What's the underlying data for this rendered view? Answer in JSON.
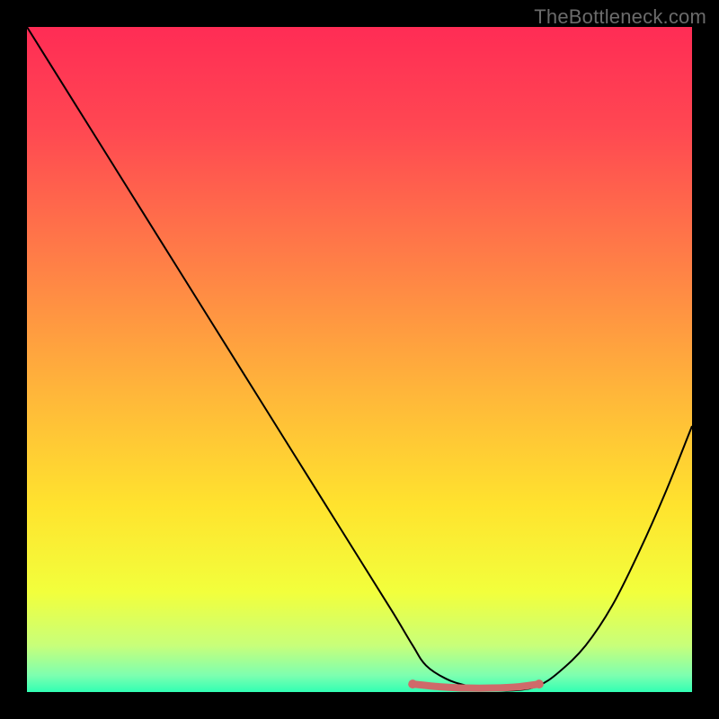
{
  "watermark": "TheBottleneck.com",
  "chart_data": {
    "type": "line",
    "title": "",
    "xlabel": "",
    "ylabel": "",
    "xlim": [
      0,
      100
    ],
    "ylim": [
      0,
      100
    ],
    "grid": false,
    "series": [
      {
        "name": "bottleneck-curve",
        "x": [
          0,
          5,
          10,
          15,
          20,
          25,
          30,
          35,
          40,
          45,
          50,
          55,
          58,
          60,
          63,
          66,
          70,
          74,
          77,
          80,
          84,
          88,
          92,
          96,
          100
        ],
        "y": [
          100,
          92,
          84,
          76,
          68,
          60,
          52,
          44,
          36,
          28,
          20,
          12,
          7,
          4,
          2,
          1,
          0.3,
          0.3,
          1,
          3,
          7,
          13,
          21,
          30,
          40
        ],
        "color": "#000000",
        "stroke_width": 2
      },
      {
        "name": "optimal-band",
        "x": [
          58,
          62,
          66,
          70,
          74,
          77
        ],
        "y": [
          1.2,
          0.8,
          0.6,
          0.6,
          0.8,
          1.2
        ],
        "color": "#cf6a6a",
        "stroke_width": 8,
        "linecap": "round",
        "endpoints": true
      }
    ],
    "background_gradient": {
      "type": "vertical",
      "stops": [
        {
          "offset": 0.0,
          "color": "#ff2c55"
        },
        {
          "offset": 0.15,
          "color": "#ff4752"
        },
        {
          "offset": 0.35,
          "color": "#ff7e47"
        },
        {
          "offset": 0.55,
          "color": "#ffb63a"
        },
        {
          "offset": 0.72,
          "color": "#ffe32e"
        },
        {
          "offset": 0.85,
          "color": "#f2ff3c"
        },
        {
          "offset": 0.93,
          "color": "#c8ff7a"
        },
        {
          "offset": 0.975,
          "color": "#7dffb0"
        },
        {
          "offset": 1.0,
          "color": "#31ffb3"
        }
      ]
    }
  }
}
